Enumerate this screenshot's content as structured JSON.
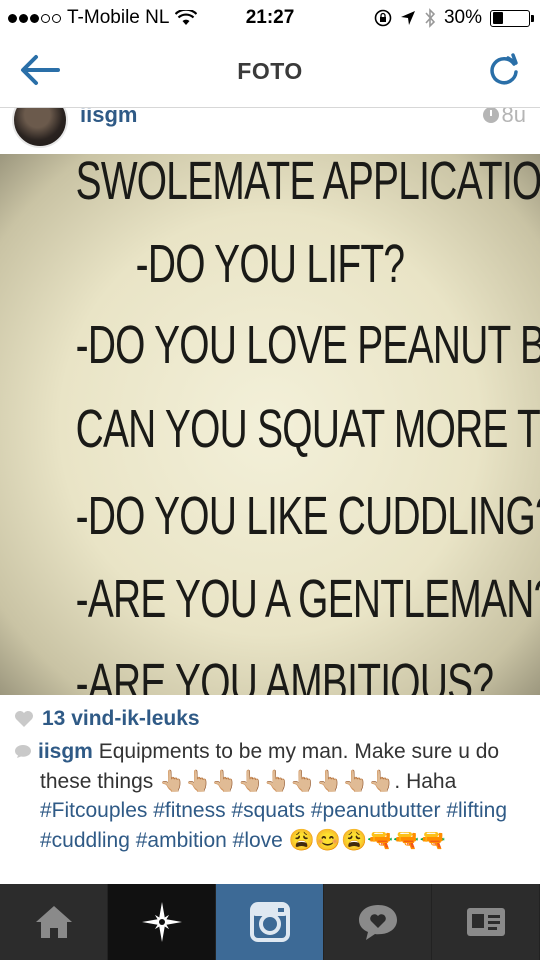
{
  "status_bar": {
    "carrier": "T-Mobile NL",
    "time": "21:27",
    "battery": "30%",
    "battery_level": 0.3
  },
  "nav": {
    "title": "FOTO"
  },
  "post": {
    "username": "iisgm",
    "age": "8u",
    "photo_lines": [
      "SWOLEMATE APPLICATION:",
      "-DO YOU LIFT?",
      "-DO YOU LOVE PEANUT BUTTER?",
      "CAN YOU SQUAT MORE THAN ME",
      "-DO YOU LIKE CUDDLING?",
      "-ARE YOU A GENTLEMAN?",
      "-ARE YOU AMBITIOUS?"
    ],
    "likes": "13 vind-ik-leuks",
    "caption": {
      "username": "iisgm",
      "text": "Equipments to be my man. Make sure u do these things 👆🏼👆🏼👆🏼👆🏼👆🏼👆🏼👆🏼👆🏼👆🏼. Haha",
      "hashtags": [
        "#Fitcouples",
        "#fitness",
        "#squats",
        "#peanutbutter",
        "#lifting",
        "#cuddling",
        "#ambition",
        "#love"
      ],
      "emoji_tail": "😩😊😩🔫🔫🔫"
    }
  },
  "tabs": [
    {
      "name": "home-icon",
      "active": false
    },
    {
      "name": "explore-icon",
      "active": false
    },
    {
      "name": "camera-icon",
      "active": true
    },
    {
      "name": "activity-icon",
      "active": false
    },
    {
      "name": "profile-icon",
      "active": false
    }
  ],
  "colors": {
    "link": "#2f5a86",
    "tabbar": "#2c2c2c",
    "tab_active": "#3d6a96",
    "nav_accent": "#2a6fa8"
  }
}
